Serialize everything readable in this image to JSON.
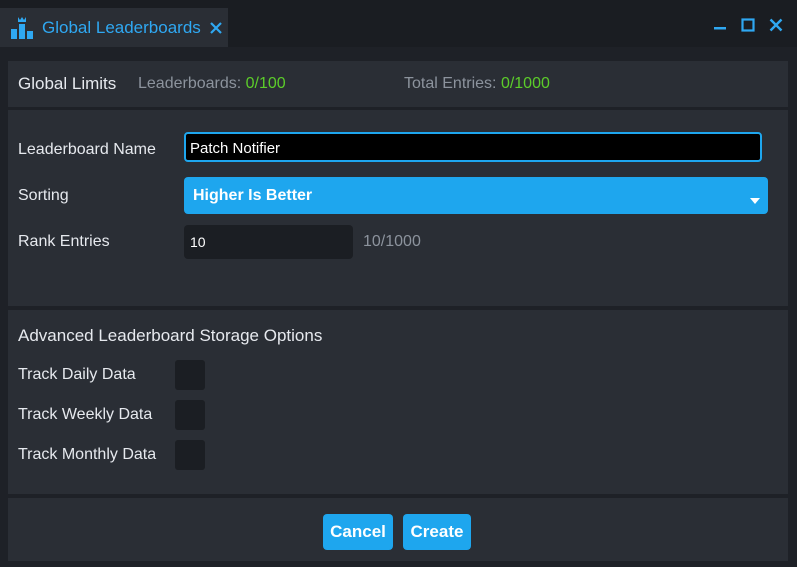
{
  "window": {
    "tab_title": "Global Leaderboards",
    "accent_color": "#1ea6ee"
  },
  "limits": {
    "label": "Global Limits",
    "leaderboards_label": "Leaderboards:",
    "leaderboards_value": "0/100",
    "entries_label": "Total Entries:",
    "entries_value": "0/1000",
    "value_color": "#5ccd2a"
  },
  "form": {
    "name_label": "Leaderboard Name",
    "name_value": "Patch Notifier",
    "sorting_label": "Sorting",
    "sorting_value": "Higher Is Better",
    "rank_label": "Rank Entries",
    "rank_value": "10",
    "rank_count": "10/1000"
  },
  "advanced": {
    "title": "Advanced Leaderboard Storage Options",
    "options": [
      {
        "label": "Track Daily Data",
        "checked": false
      },
      {
        "label": "Track Weekly Data",
        "checked": false
      },
      {
        "label": "Track Monthly Data",
        "checked": false
      }
    ]
  },
  "buttons": {
    "cancel": "Cancel",
    "create": "Create"
  }
}
